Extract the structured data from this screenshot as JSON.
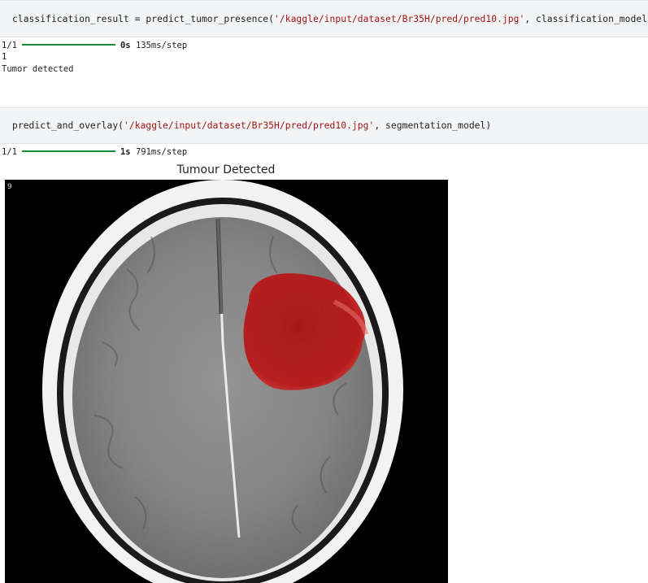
{
  "cell1": {
    "code_prefix": "classification_result = predict_tumor_presence(",
    "code_string": "'/kaggle/input/dataset/Br35H/pred/pred10.jpg'",
    "code_suffix": ", classification_model)",
    "output": {
      "step": "1/1",
      "time": "0s",
      "rate": "135ms/step",
      "lines": [
        "1",
        "Tumor detected"
      ]
    }
  },
  "cell2": {
    "code_prefix": "predict_and_overlay(",
    "code_string": "'/kaggle/input/dataset/Br35H/pred/pred10.jpg'",
    "code_suffix": ", segmentation_model)",
    "output": {
      "step": "1/1",
      "time": "1s",
      "rate": "791ms/step"
    }
  },
  "figure": {
    "title": "Tumour Detected",
    "scan_corner_label": "9"
  },
  "colors": {
    "string": "#a31515",
    "progress": "#1a8a3c",
    "overlay": "#d01818",
    "cell_background": "#f3f4f5"
  }
}
